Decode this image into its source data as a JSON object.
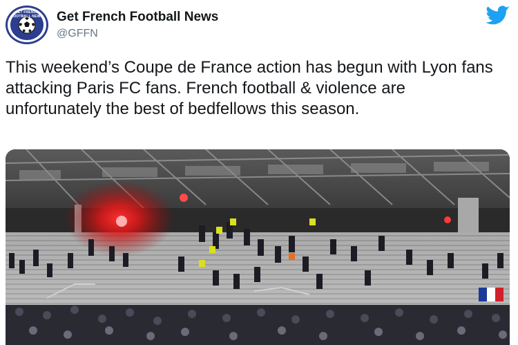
{
  "author": {
    "name": "Get French Football News",
    "handle": "@GFFN",
    "avatar_icon": "gffn-logo-icon",
    "avatar_ring_text": "GET FRENCH FOOTBALL NEWS"
  },
  "platform_icon": "twitter-bird-icon",
  "colors": {
    "twitter_blue": "#1da1f2",
    "handle_gray": "#657786",
    "flare_red": "#ff2a2a"
  },
  "tweet": {
    "text": "This weekend’s Coupe de France action has begun with Lyon fans attacking Paris FC fans. French football & violence are unfortunately the best of bedfellows this season."
  },
  "media": {
    "icon": "stadium-photo"
  }
}
